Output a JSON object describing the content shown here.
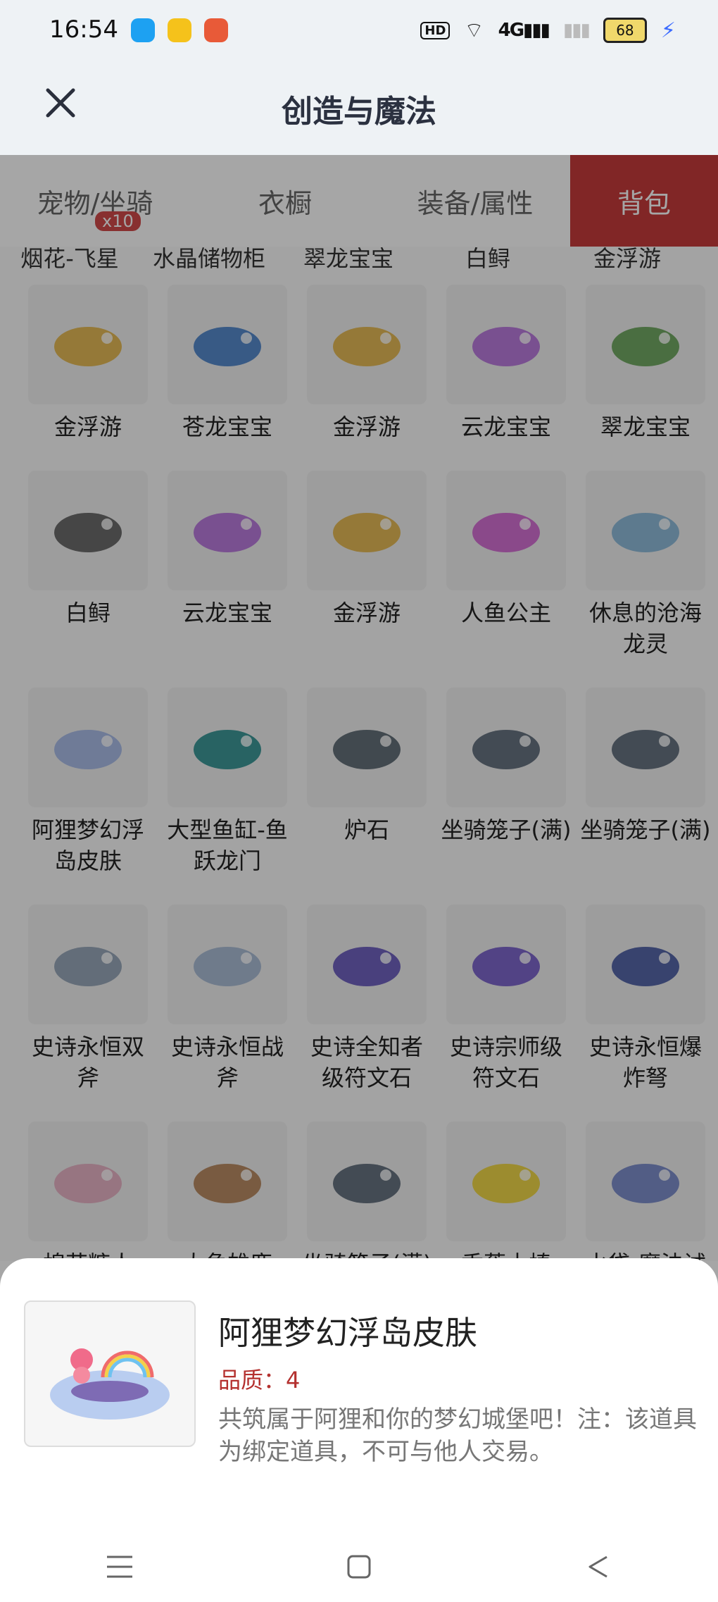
{
  "status": {
    "time": "16:54",
    "apps": [
      "qq-app-icon",
      "yellow-app-icon",
      "58-app-icon"
    ],
    "hd": "HD",
    "network": "4G",
    "battery": "68"
  },
  "appbar": {
    "title": "创造与魔法"
  },
  "tabs": [
    {
      "label": "宠物/坐骑",
      "badge": "x10"
    },
    {
      "label": "衣橱"
    },
    {
      "label": "装备/属性"
    },
    {
      "label": "背包"
    }
  ],
  "partial_row": [
    "烟花-飞星",
    "水晶储物柜",
    "翠龙宝宝",
    "白鲟",
    "金浮游"
  ],
  "items": [
    {
      "label": "金浮游",
      "icon": "golden-fish-icon",
      "color": "#e3b23c"
    },
    {
      "label": "苍龙宝宝",
      "icon": "blue-dragon-icon",
      "color": "#3b78c7"
    },
    {
      "label": "金浮游",
      "icon": "golden-fish-icon",
      "color": "#e3b23c"
    },
    {
      "label": "云龙宝宝",
      "icon": "cloud-dragon-icon",
      "color": "#b066d9"
    },
    {
      "label": "翠龙宝宝",
      "icon": "green-dragon-icon",
      "color": "#5c9c4b"
    },
    {
      "label": "白鲟",
      "icon": "sturgeon-icon",
      "color": "#555"
    },
    {
      "label": "云龙宝宝",
      "icon": "cloud-dragon-icon",
      "color": "#b066d9"
    },
    {
      "label": "金浮游",
      "icon": "golden-fish-icon",
      "color": "#e3b23c"
    },
    {
      "label": "人鱼公主",
      "icon": "mermaid-icon",
      "color": "#d05bd0"
    },
    {
      "label": "休息的沧海龙灵",
      "icon": "sea-dragon-icon",
      "color": "#7fb3d6"
    },
    {
      "label": "阿狸梦幻浮岛皮肤",
      "icon": "floating-island-icon",
      "color": "#9fb5e8"
    },
    {
      "label": "大型鱼缸-鱼跃龙门",
      "icon": "fish-tank-icon",
      "color": "#1f8a8a"
    },
    {
      "label": "炉石",
      "icon": "hearthstone-icon",
      "color": "#4c5a65"
    },
    {
      "label": "坐骑笼子(满)",
      "icon": "mount-cage-icon",
      "color": "#4f5d6d"
    },
    {
      "label": "坐骑笼子(满)",
      "icon": "mount-cage-icon",
      "color": "#4f5d6d"
    },
    {
      "label": "史诗永恒双斧",
      "icon": "double-axe-icon",
      "color": "#8a9bb0"
    },
    {
      "label": "史诗永恒战斧",
      "icon": "battle-axe-icon",
      "color": "#9fb4d1"
    },
    {
      "label": "史诗全知者级符文石",
      "icon": "rune-stone-icon",
      "color": "#5a4ab8"
    },
    {
      "label": "史诗宗师级符文石",
      "icon": "rune-stone-icon",
      "color": "#6b4fc6"
    },
    {
      "label": "史诗永恒爆炸弩",
      "icon": "crossbow-icon",
      "color": "#3b4f9c"
    },
    {
      "label": "棉花糖人",
      "icon": "cotton-candy-icon",
      "color": "#e7a9bf"
    },
    {
      "label": "大角雄鹿",
      "icon": "stag-icon",
      "color": "#b27a4b"
    },
    {
      "label": "坐骑笼子(满)",
      "icon": "mount-cage-icon",
      "color": "#4f5d6d"
    },
    {
      "label": "香蕉木棒",
      "icon": "banana-icon",
      "color": "#f0d22c"
    },
    {
      "label": "水袋-魔法试剂瓶",
      "icon": "potion-icon",
      "color": "#6b7fc5"
    }
  ],
  "detail": {
    "title": "阿狸梦幻浮岛皮肤",
    "quality": "品质：4",
    "description": "共筑属于阿狸和你的梦幻城堡吧！注：该道具为绑定道具，不可与他人交易。",
    "icon": "floating-island-icon"
  },
  "navbar": [
    "menu-icon",
    "home-icon",
    "back-icon"
  ]
}
